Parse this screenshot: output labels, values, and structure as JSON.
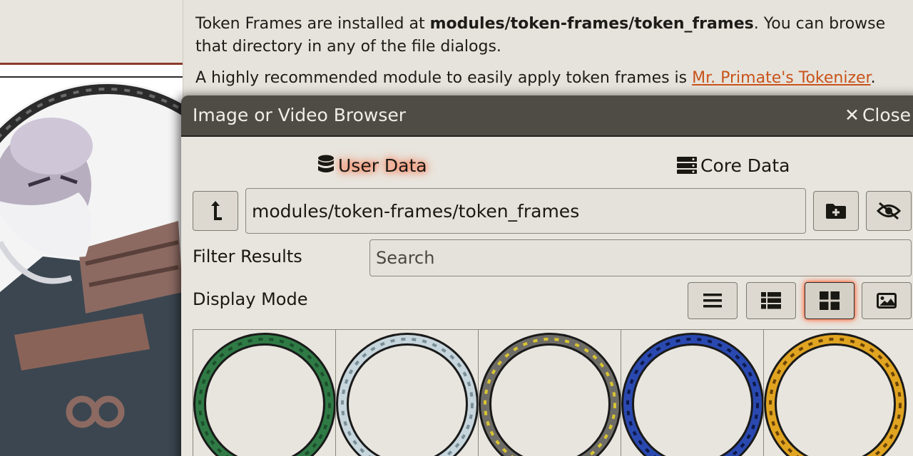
{
  "journal": {
    "p1_prefix": "Token Frames are installed at ",
    "p1_path": "modules/token-frames/token_frames",
    "p1_suffix": ". You can browse that directory in any of the file dialogs.",
    "p2_prefix": "A highly recommended module to easily apply token frames is ",
    "p2_link": "Mr. Primate's Tokenizer",
    "p2_suffix": "."
  },
  "browser": {
    "title": "Image or Video Browser",
    "close_label": "Close",
    "tabs": [
      {
        "label": "User Data",
        "icon": "database-icon",
        "active": true
      },
      {
        "label": "Core Data",
        "icon": "server-icon",
        "active": false
      }
    ],
    "path_value": "modules/token-frames/token_frames",
    "filter_label": "Filter Results",
    "search_placeholder": "Search",
    "display_label": "Display Mode",
    "display_modes": [
      {
        "name": "list",
        "icon": "bars-icon",
        "active": false
      },
      {
        "name": "tiles",
        "icon": "th-list-icon",
        "active": false
      },
      {
        "name": "thumbs",
        "icon": "th-large-icon",
        "active": true
      },
      {
        "name": "images",
        "icon": "image-icon",
        "active": false
      }
    ],
    "thumbnails": [
      {
        "color": "#2f7a45",
        "accent": "#1c4f2c"
      },
      {
        "color": "#c7d6dc",
        "accent": "#7b8f98"
      },
      {
        "color": "#6e6c66",
        "accent": "#d9c531"
      },
      {
        "color": "#2a49b0",
        "accent": "#0d1a4a"
      },
      {
        "color": "#e0a420",
        "accent": "#6b4308"
      }
    ]
  },
  "colors": {
    "accent_glow": "#ff6a3d",
    "link": "#c8531b",
    "titlebar": "#4f4c46"
  }
}
